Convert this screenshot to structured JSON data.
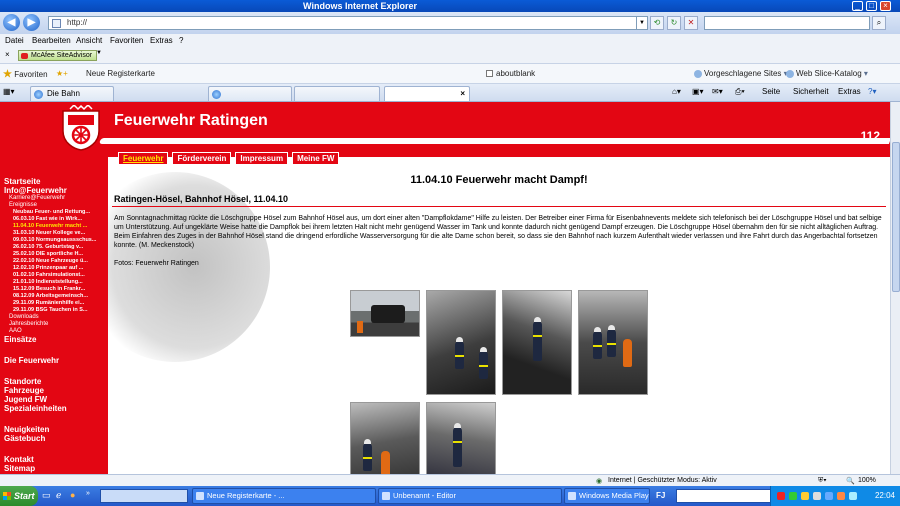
{
  "browser": {
    "window_title": "Windows Internet Explorer",
    "address": "http://",
    "menu": [
      "Datei",
      "Bearbeiten",
      "Ansicht",
      "Favoriten",
      "Extras",
      "?"
    ],
    "mcafee": "McAfee SiteAdvisor",
    "favorites_label": "Favoriten",
    "new_tab_label": "Neue Registerkarte",
    "aboutblank": "aboutblank",
    "suggested_sites": "Vorgeschlagene Sites",
    "web_slice": "Web Slice-Katalog",
    "tabs": [
      "Die Bahn",
      ""
    ],
    "tools": [
      "Seite",
      "Sicherheit",
      "Extras"
    ]
  },
  "site": {
    "title": "Feuerwehr Ratingen",
    "emergency_number": "112",
    "top_nav": [
      "Feuerwehr",
      "Förderverein",
      "Impressum",
      "Meine FW"
    ]
  },
  "sidebar": {
    "main": [
      "Startseite",
      "Info@Feuerwehr"
    ],
    "sub1": [
      "Karriere@Feuerwehr",
      "Ereignisse"
    ],
    "events": [
      "Neubau Feuer- und Rettung...",
      "06.03.10 Fast wie in Wirk...",
      "11.04.10 Feuerwehr macht ...",
      "31.03.10 Neuer Kollege ve...",
      "09.03.10 Normungsaussschus...",
      "26.02.10 75. Geburtstag v...",
      "25.02.10 DIE sportliche H...",
      "22.02.10 Neue Fahrzeuge ü...",
      "12.02.10 Prinzenpaar auf ...",
      "01.02.10 Fahrsimulationst...",
      "21.01.10 Indienststellung...",
      "15.12.09 Besuch in Frankr...",
      "08.12.09 Arbeitsgemeinsch...",
      "29.11.09 Rumänienhilfe ei...",
      "29.11.09 BSG Tauchen in S..."
    ],
    "sub_after": [
      "Downloads",
      "Jahresberichte",
      "AAO"
    ],
    "main2": [
      "Einsätze",
      "Die Feuerwehr",
      "Standorte",
      "Fahrzeuge",
      "Jugend FW",
      "Spezialeinheiten",
      "Neuigkeiten",
      "Gästebuch",
      "Kontakt",
      "Sitemap"
    ]
  },
  "article": {
    "headline": "11.04.10 Feuerwehr macht Dampf!",
    "subhead": "Ratingen-Hösel, Bahnhof Hösel, 11.04.10",
    "body": "Am Sonntagnachmittag rückte die Löschgruppe Hösel zum Bahnhof Hösel aus, um dort einer alten \"Dampflokdame\" Hilfe zu leisten. Der Betreiber einer Firma für Eisenbahnevents meldete sich telefonisch bei der Löschgruppe Hösel und bat selbige um Unterstützung. Auf ungeklärte Weise hatte die Dampflok bei ihrem letzten Halt nicht mehr genügend Wasser im Tank und konnte dadurch nicht genügend Dampf erzeugen. Die Löschgruppe Hösel übernahm den für sie nicht alltäglichen Auftrag. Beim Einfahren des Zuges in der Bahnhof Hösel stand die dringend erfordliche Wasserversorgung für die alte Dame schon bereit, so dass sie den Bahnhof nach kurzem Aufenthalt wieder verlassen und ihre Fahrt durch das Angerbachtal fortsetzen konnte. (M. Meckenstock)",
    "credit": "Fotos: Feuerwehr Ratingen"
  },
  "status": {
    "zone": "Internet | Geschützter Modus: Aktiv",
    "zoom": "100%"
  },
  "taskbar": {
    "start": "Start",
    "items": [
      "Neue Registerkarte - ...",
      "Unbenannt - Editor",
      "Windows Media Player"
    ],
    "lang": "FJ",
    "clock": "22:04"
  }
}
